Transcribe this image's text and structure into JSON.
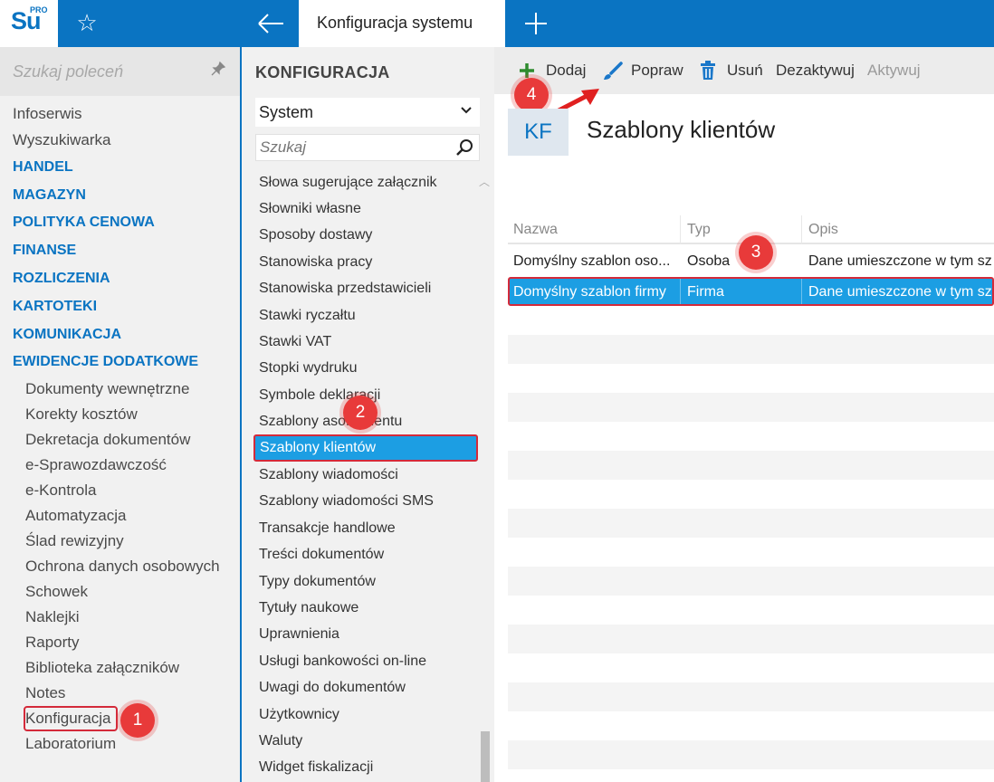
{
  "topbar": {
    "logo_text": "Su",
    "logo_sup": "PRO",
    "tab_title": "Konfiguracja systemu"
  },
  "leftnav": {
    "search_placeholder": "Szukaj poleceń",
    "items": [
      {
        "label": "Infoserwis",
        "type": "item"
      },
      {
        "label": "Wyszukiwarka",
        "type": "item"
      },
      {
        "label": "HANDEL",
        "type": "head"
      },
      {
        "label": "MAGAZYN",
        "type": "head"
      },
      {
        "label": "POLITYKA CENOWA",
        "type": "head"
      },
      {
        "label": "FINANSE",
        "type": "head"
      },
      {
        "label": "ROZLICZENIA",
        "type": "head"
      },
      {
        "label": "KARTOTEKI",
        "type": "head"
      },
      {
        "label": "KOMUNIKACJA",
        "type": "head"
      },
      {
        "label": "EWIDENCJE DODATKOWE",
        "type": "head"
      }
    ],
    "subitems": [
      "Dokumenty wewnętrzne",
      "Korekty kosztów",
      "Dekretacja dokumentów",
      "e-Sprawozdawczość",
      "e-Kontrola",
      "Automatyzacja",
      "Ślad rewizyjny",
      "Ochrona danych osobowych",
      "Schowek",
      "Naklejki",
      "Raporty",
      "Biblioteka załączników",
      "Notes",
      "Konfiguracja",
      "Laboratorium"
    ]
  },
  "config": {
    "title": "KONFIGURACJA",
    "selected_group": "System",
    "search_placeholder": "Szukaj",
    "items": [
      "Słowa sugerujące załącznik",
      "Słowniki własne",
      "Sposoby dostawy",
      "Stanowiska pracy",
      "Stanowiska przedstawicieli",
      "Stawki ryczałtu",
      "Stawki VAT",
      "Stopki wydruku",
      "Symbole deklaracji",
      "Szablony asortymentu",
      "Szablony klientów",
      "Szablony wiadomości",
      "Szablony wiadomości SMS",
      "Transakcje handlowe",
      "Treści dokumentów",
      "Typy dokumentów",
      "Tytuły naukowe",
      "Uprawnienia",
      "Usługi bankowości on-line",
      "Uwagi do dokumentów",
      "Użytkownicy",
      "Waluty",
      "Widget fiskalizacji"
    ],
    "selected_item": "Szablony klientów"
  },
  "toolbar": {
    "add": "Dodaj",
    "edit": "Popraw",
    "delete": "Usuń",
    "deactivate": "Dezaktywuj",
    "activate": "Aktywuj"
  },
  "content": {
    "badge": "KF",
    "title": "Szablony klientów",
    "columns": [
      "Nazwa",
      "Typ",
      "Opis"
    ],
    "rows": [
      {
        "name": "Domyślny szablon oso...",
        "type": "Osoba",
        "desc": "Dane umieszczone w tym sz"
      },
      {
        "name": "Domyślny szablon firmy",
        "type": "Firma",
        "desc": "Dane umieszczone w tym sz"
      }
    ]
  },
  "markers": [
    "1",
    "2",
    "3",
    "4"
  ],
  "colors": {
    "brand_blue": "#0a74c2",
    "selection_blue": "#1c9ee3",
    "marker_red": "#e83a3a",
    "add_green": "#2e8b2e"
  }
}
